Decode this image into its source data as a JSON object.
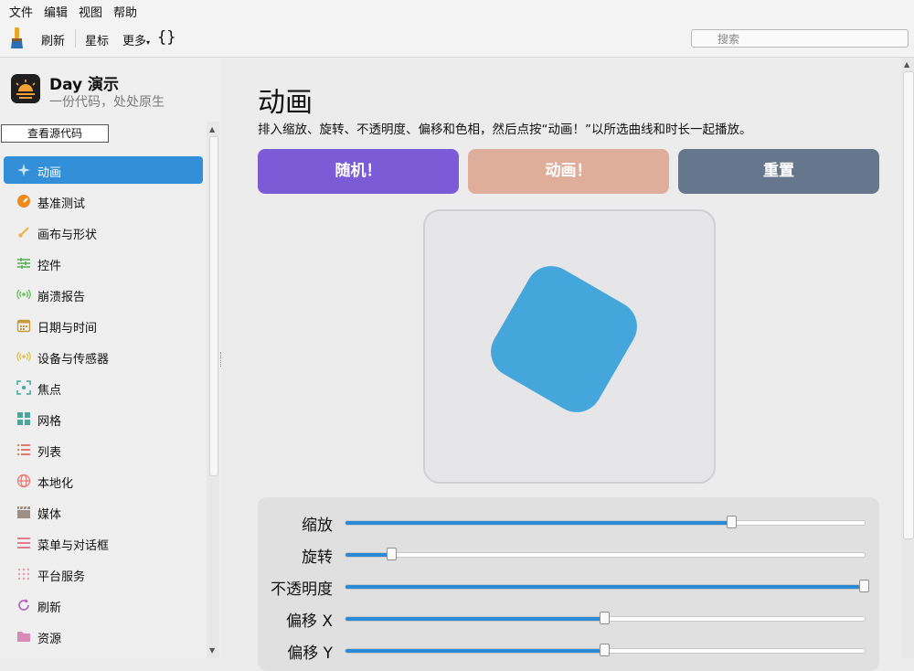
{
  "menu": [
    "文件",
    "编辑",
    "视图",
    "帮助"
  ],
  "toolbar": {
    "refresh": "刷新",
    "star": "星标",
    "more": "更多",
    "braces": "{}",
    "search_placeholder": "搜索"
  },
  "app": {
    "title": "Day 演示",
    "subtitle": "一份代码，处处原生"
  },
  "tooltip": "查看源代码",
  "sidebar": {
    "items": [
      {
        "label": "动画",
        "icon": "sparkle-icon",
        "color": "#ffffff",
        "selected": true
      },
      {
        "label": "基准测试",
        "icon": "gauge-icon",
        "color": "#f08a1c"
      },
      {
        "label": "画布与形状",
        "icon": "brush-icon",
        "color": "#f3b24b"
      },
      {
        "label": "控件",
        "icon": "sliders-icon",
        "color": "#4caf50"
      },
      {
        "label": "崩溃报告",
        "icon": "broadcast-icon",
        "color": "#6bbf59"
      },
      {
        "label": "日期与时间",
        "icon": "calendar-icon",
        "color": "#c79a3b"
      },
      {
        "label": "设备与传感器",
        "icon": "sensor-icon",
        "color": "#e2c24a"
      },
      {
        "label": "焦点",
        "icon": "focus-icon",
        "color": "#3aa8a8"
      },
      {
        "label": "网格",
        "icon": "grid-icon",
        "color": "#4aa89a"
      },
      {
        "label": "列表",
        "icon": "list-icon",
        "color": "#e0533d"
      },
      {
        "label": "本地化",
        "icon": "globe-icon",
        "color": "#e8736a"
      },
      {
        "label": "媒体",
        "icon": "clapper-icon",
        "color": "#9b8f86"
      },
      {
        "label": "菜单与对话框",
        "icon": "menu-icon",
        "color": "#e0607a"
      },
      {
        "label": "平台服务",
        "icon": "dots-grid-icon",
        "color": "#e89aa8"
      },
      {
        "label": "刷新",
        "icon": "refresh-icon",
        "color": "#b05cc0"
      },
      {
        "label": "资源",
        "icon": "folder-icon",
        "color": "#d98ab8"
      }
    ]
  },
  "main": {
    "title": "动画",
    "description": "排入缩放、旋转、不透明度、偏移和色相，然后点按“动画！”以所选曲线和时长一起播放。",
    "buttons": [
      {
        "label": "随机！",
        "color": "#7c5cd6"
      },
      {
        "label": "动画！",
        "color": "#dfae9b"
      },
      {
        "label": "重置",
        "color": "#66768d"
      }
    ],
    "shape_color": "#44a6da",
    "sliders": [
      {
        "label": "缩放",
        "value": 0.745
      },
      {
        "label": "旋转",
        "value": 0.09
      },
      {
        "label": "不透明度",
        "value": 1.0
      },
      {
        "label": "偏移 X",
        "value": 0.5
      },
      {
        "label": "偏移 Y",
        "value": 0.5
      }
    ]
  }
}
